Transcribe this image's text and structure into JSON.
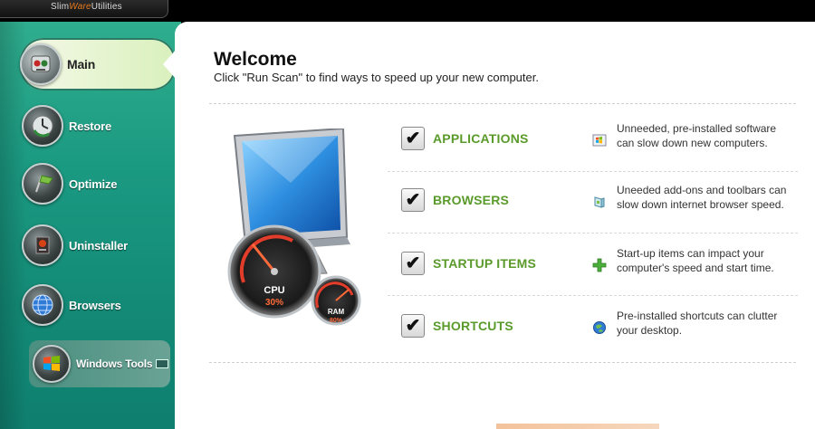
{
  "app": {
    "logo_part1": "Slim",
    "logo_part2": "Ware",
    "logo_part3": "Utilities"
  },
  "sidebar": {
    "items": [
      {
        "label": "Main",
        "icon": "robot-icon",
        "selected": true
      },
      {
        "label": "Restore",
        "icon": "restore-clock-icon"
      },
      {
        "label": "Optimize",
        "icon": "flag-icon"
      },
      {
        "label": "Uninstaller",
        "icon": "uninstall-box-icon"
      },
      {
        "label": "Browsers",
        "icon": "globe-icon"
      },
      {
        "label": "Windows Tools",
        "icon": "windows-logo-icon"
      }
    ]
  },
  "main": {
    "title": "Welcome",
    "subtitle": "Click \"Run Scan\" to find ways to speed up your new computer.",
    "gauges": {
      "cpu_label": "CPU",
      "cpu_value": "30%",
      "ram_label": "RAM",
      "ram_value": "80%"
    },
    "rows": [
      {
        "title": "APPLICATIONS",
        "checked": true,
        "icon": "windows-app-icon",
        "desc1": "Unneeded, pre-installed software",
        "desc2": "can slow down new computers."
      },
      {
        "title": "BROWSERS",
        "checked": true,
        "icon": "puzzle-addon-icon",
        "desc1": "Uneeded add-ons and toolbars can",
        "desc2": "slow down internet browser speed."
      },
      {
        "title": "STARTUP ITEMS",
        "checked": true,
        "icon": "plus-icon",
        "desc1": "Start-up items can impact your",
        "desc2": "computer's speed and start time."
      },
      {
        "title": "SHORTCUTS",
        "checked": true,
        "icon": "globe-small-icon",
        "desc1": "Pre-installed shortcuts can clutter",
        "desc2": "your desktop."
      }
    ]
  },
  "colors": {
    "accent_green": "#5a9a2a",
    "sidebar_teal": "#1b9a82"
  }
}
